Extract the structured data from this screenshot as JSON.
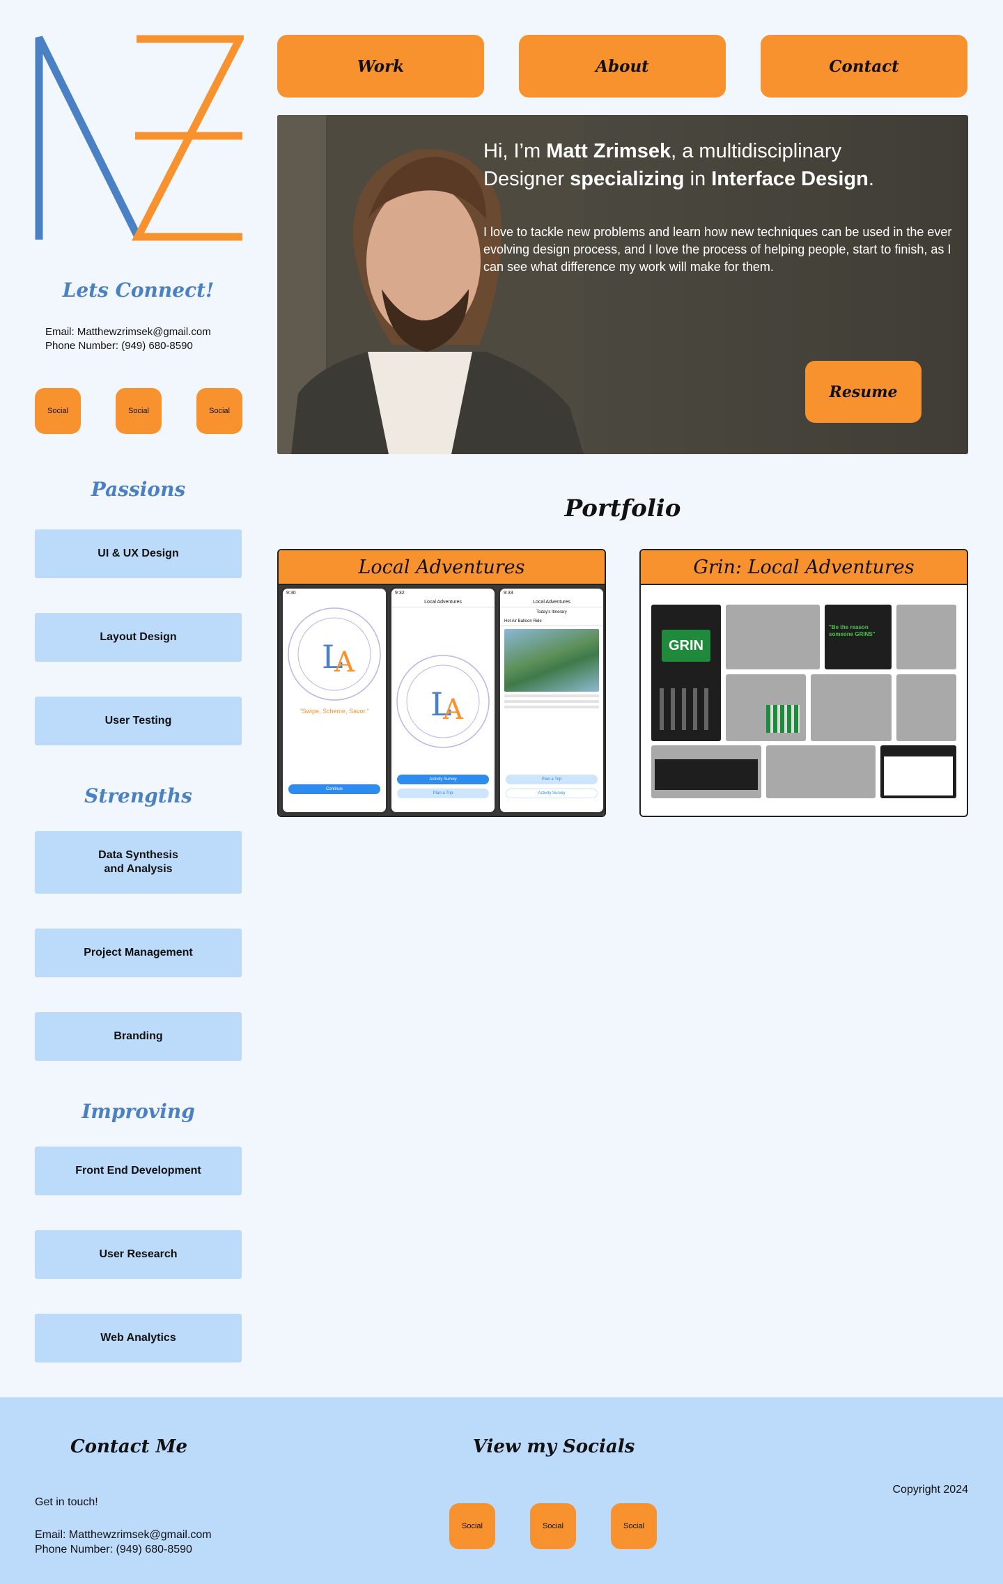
{
  "brand": {
    "logo_alt": "MZ",
    "colors": {
      "blue": "#4a81c4",
      "orange": "#f7922f",
      "light_blue": "#bcdafa",
      "bg": "#f2f7fd"
    }
  },
  "nav": {
    "items": [
      "Work",
      "About",
      "Contact"
    ]
  },
  "sidebar": {
    "connect_title": "Lets Connect!",
    "email": "Email: Matthewzrimsek@gmail.com",
    "phone": "Phone Number: (949) 680-8590",
    "socials": [
      "Social",
      "Social",
      "Social"
    ],
    "passions_title": "Passions",
    "passions": [
      "UI & UX Design",
      "Layout Design",
      "User Testing"
    ],
    "strengths_title": "Strengths",
    "strengths": [
      "Data Synthesis\nand Analysis",
      "Project Management",
      "Branding"
    ],
    "improving_title": "Improving",
    "improving": [
      "Front End Development",
      "User Research",
      "Web Analytics"
    ]
  },
  "hero": {
    "intro_hi": "Hi, I’m ",
    "intro_name": "Matt Zrimsek",
    "intro_mid": ", a multidisciplinary",
    "intro_line2_a": "Designer ",
    "intro_line2_b": "specializing",
    "intro_line2_c": " in ",
    "intro_line2_d": "Interface Design",
    "intro_line2_e": ".",
    "body": "I love to tackle new problems and learn how new techniques can be used in the ever evolving design process, and I love the process of helping people, start to finish, as I can see what difference my work will make for them.",
    "resume_label": "Resume"
  },
  "portfolio": {
    "title": "Portfolio",
    "cards": [
      {
        "title": "Local Adventures",
        "phone_header": "Local Adventures",
        "tagline": "\"Swipe, Scheme, Savor.\"",
        "continue": "Continue",
        "activity_survey": "Activity Survey",
        "plan_trip": "Plan a Trip",
        "itinerary": "Today's Itinerary",
        "ride": "Hot Air Balloon Ride",
        "time1": "9:30",
        "time2": "9:32",
        "time3": "9:33"
      },
      {
        "title": "Grin: Local Adventures",
        "grin_logo": "GRIN",
        "slogan": "\"Be the reason someone GRINS\""
      }
    ]
  },
  "footer": {
    "contact_title": "Contact Me",
    "get_in_touch": "Get in touch!",
    "email": "Email: Matthewzrimsek@gmail.com",
    "phone": "Phone Number: (949) 680-8590",
    "socials_title": "View my Socials",
    "socials": [
      "Social",
      "Social",
      "Social"
    ],
    "copyright": "Copyright 2024"
  }
}
